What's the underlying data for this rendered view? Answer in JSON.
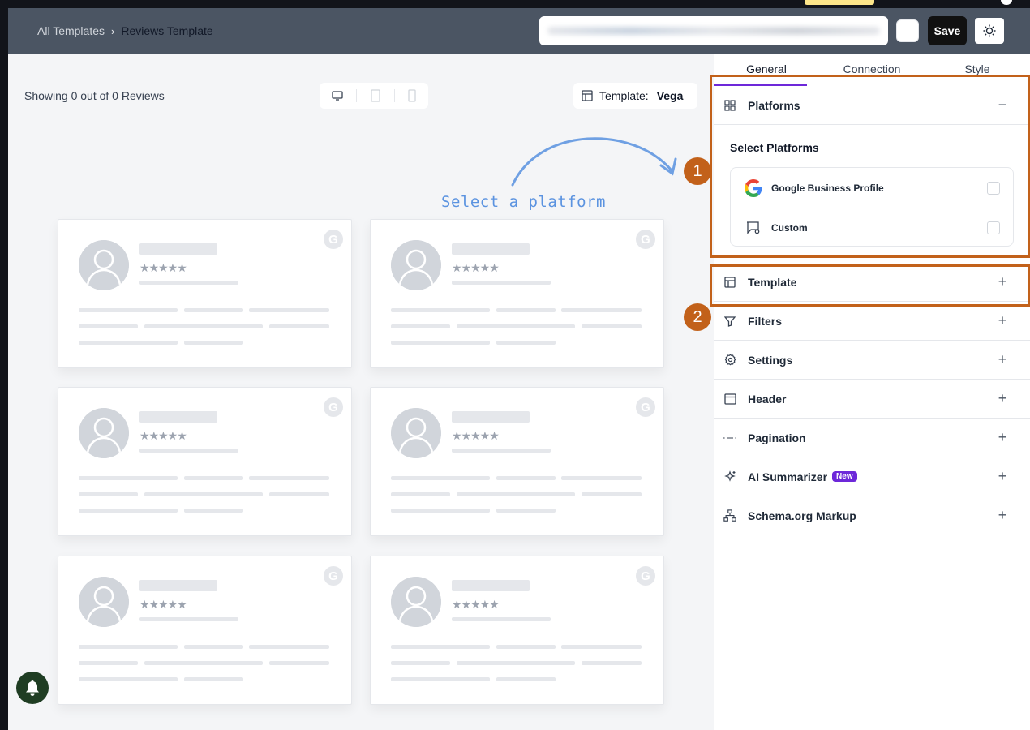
{
  "header": {
    "breadcrumb_root": "All Templates",
    "breadcrumb_separator": "›",
    "breadcrumb_current": "Reviews Template",
    "save_label": "Save"
  },
  "preview": {
    "showing_text": "Showing 0 out of 0 Reviews",
    "template_label": "Template:",
    "template_value": "Vega",
    "hint_text": "Select a platform",
    "card_stars": "★★★★★",
    "card_badge": "G"
  },
  "panel": {
    "tabs": [
      "General",
      "Connection",
      "Style"
    ],
    "active_tab": "General",
    "sections": {
      "platforms": "Platforms",
      "template": "Template",
      "filters": "Filters",
      "settings": "Settings",
      "header": "Header",
      "pagination": "Pagination",
      "ai_summarizer": "AI Summarizer",
      "ai_badge": "New",
      "schema": "Schema.org Markup"
    },
    "toggle_open": "−",
    "toggle_closed": "+",
    "select_platforms_title": "Select Platforms",
    "platforms": [
      "Google Business Profile",
      "Custom"
    ]
  },
  "annotations": [
    "1",
    "2"
  ],
  "colors": {
    "accent": "#6d28d9",
    "highlight": "#c2611a",
    "hint": "#5b93e0",
    "header_bg": "#4b5563"
  }
}
